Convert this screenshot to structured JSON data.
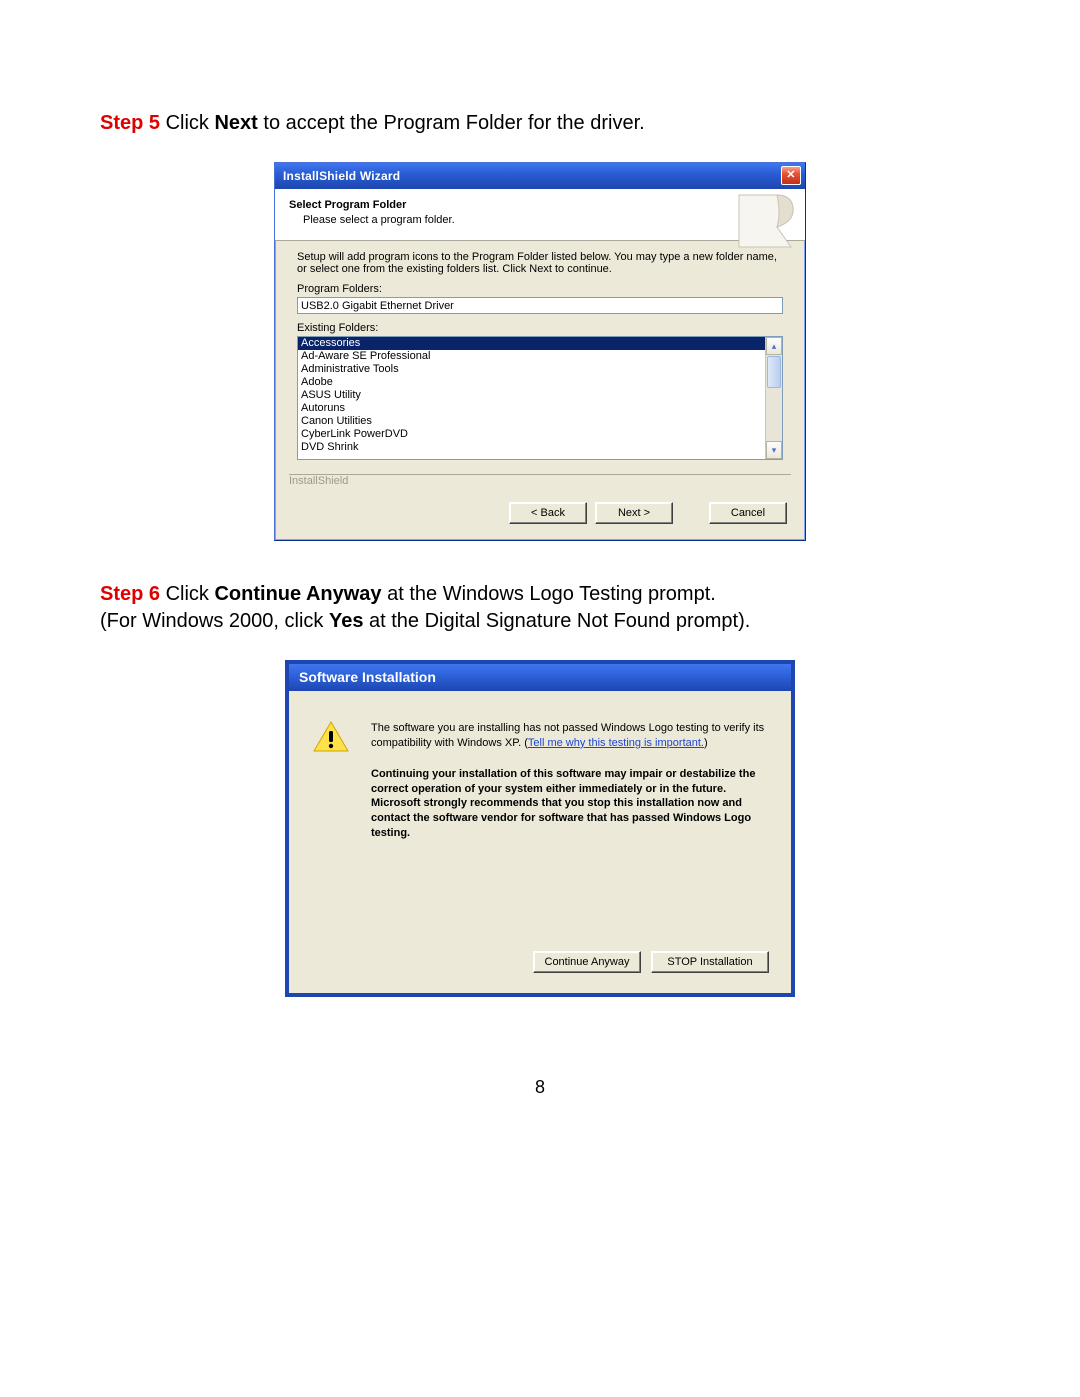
{
  "step5": {
    "label": "Step 5",
    "instr_a": " Click ",
    "instr_b": "Next",
    "instr_c": " to accept the Program Folder for the driver."
  },
  "wizard": {
    "title": "InstallShield Wizard",
    "header_title": "Select Program Folder",
    "header_sub": "Please select a program folder.",
    "desc": "Setup will add program icons to the Program Folder listed below.  You may type a new folder name, or select one from the existing folders list.  Click Next to continue.",
    "label_program_folders": "Program Folders:",
    "program_folder_value": "USB2.0 Gigabit Ethernet Driver",
    "label_existing": "Existing Folders:",
    "existing_items": [
      "Accessories",
      "Ad-Aware SE Professional",
      "Administrative Tools",
      "Adobe",
      "ASUS Utility",
      "Autoruns",
      "Canon Utilities",
      "CyberLink PowerDVD",
      "DVD Shrink"
    ],
    "brand": "InstallShield",
    "btn_back": "< Back",
    "btn_next": "Next >",
    "btn_cancel": "Cancel"
  },
  "step6": {
    "label": "Step 6",
    "l1a": " Click ",
    "l1b": "Continue Anyway",
    "l1c": " at the Windows Logo Testing prompt.",
    "l2a": "(For Windows 2000, click ",
    "l2b": "Yes",
    "l2c": " at the Digital Signature Not Found prompt)."
  },
  "softinst": {
    "title": "Software Installation",
    "para1a": "The software you are installing has not passed Windows Logo testing to verify its compatibility with Windows XP. (",
    "link": "Tell me why this testing is important.",
    "para1b": ")",
    "bold": "Continuing your installation of this software may impair or destabilize the correct operation of your system either immediately or in the future. Microsoft strongly recommends that you stop this installation now and contact the software vendor for software that has passed Windows Logo testing.",
    "btn_continue": "Continue Anyway",
    "btn_stop": "STOP Installation"
  },
  "page_number": "8"
}
